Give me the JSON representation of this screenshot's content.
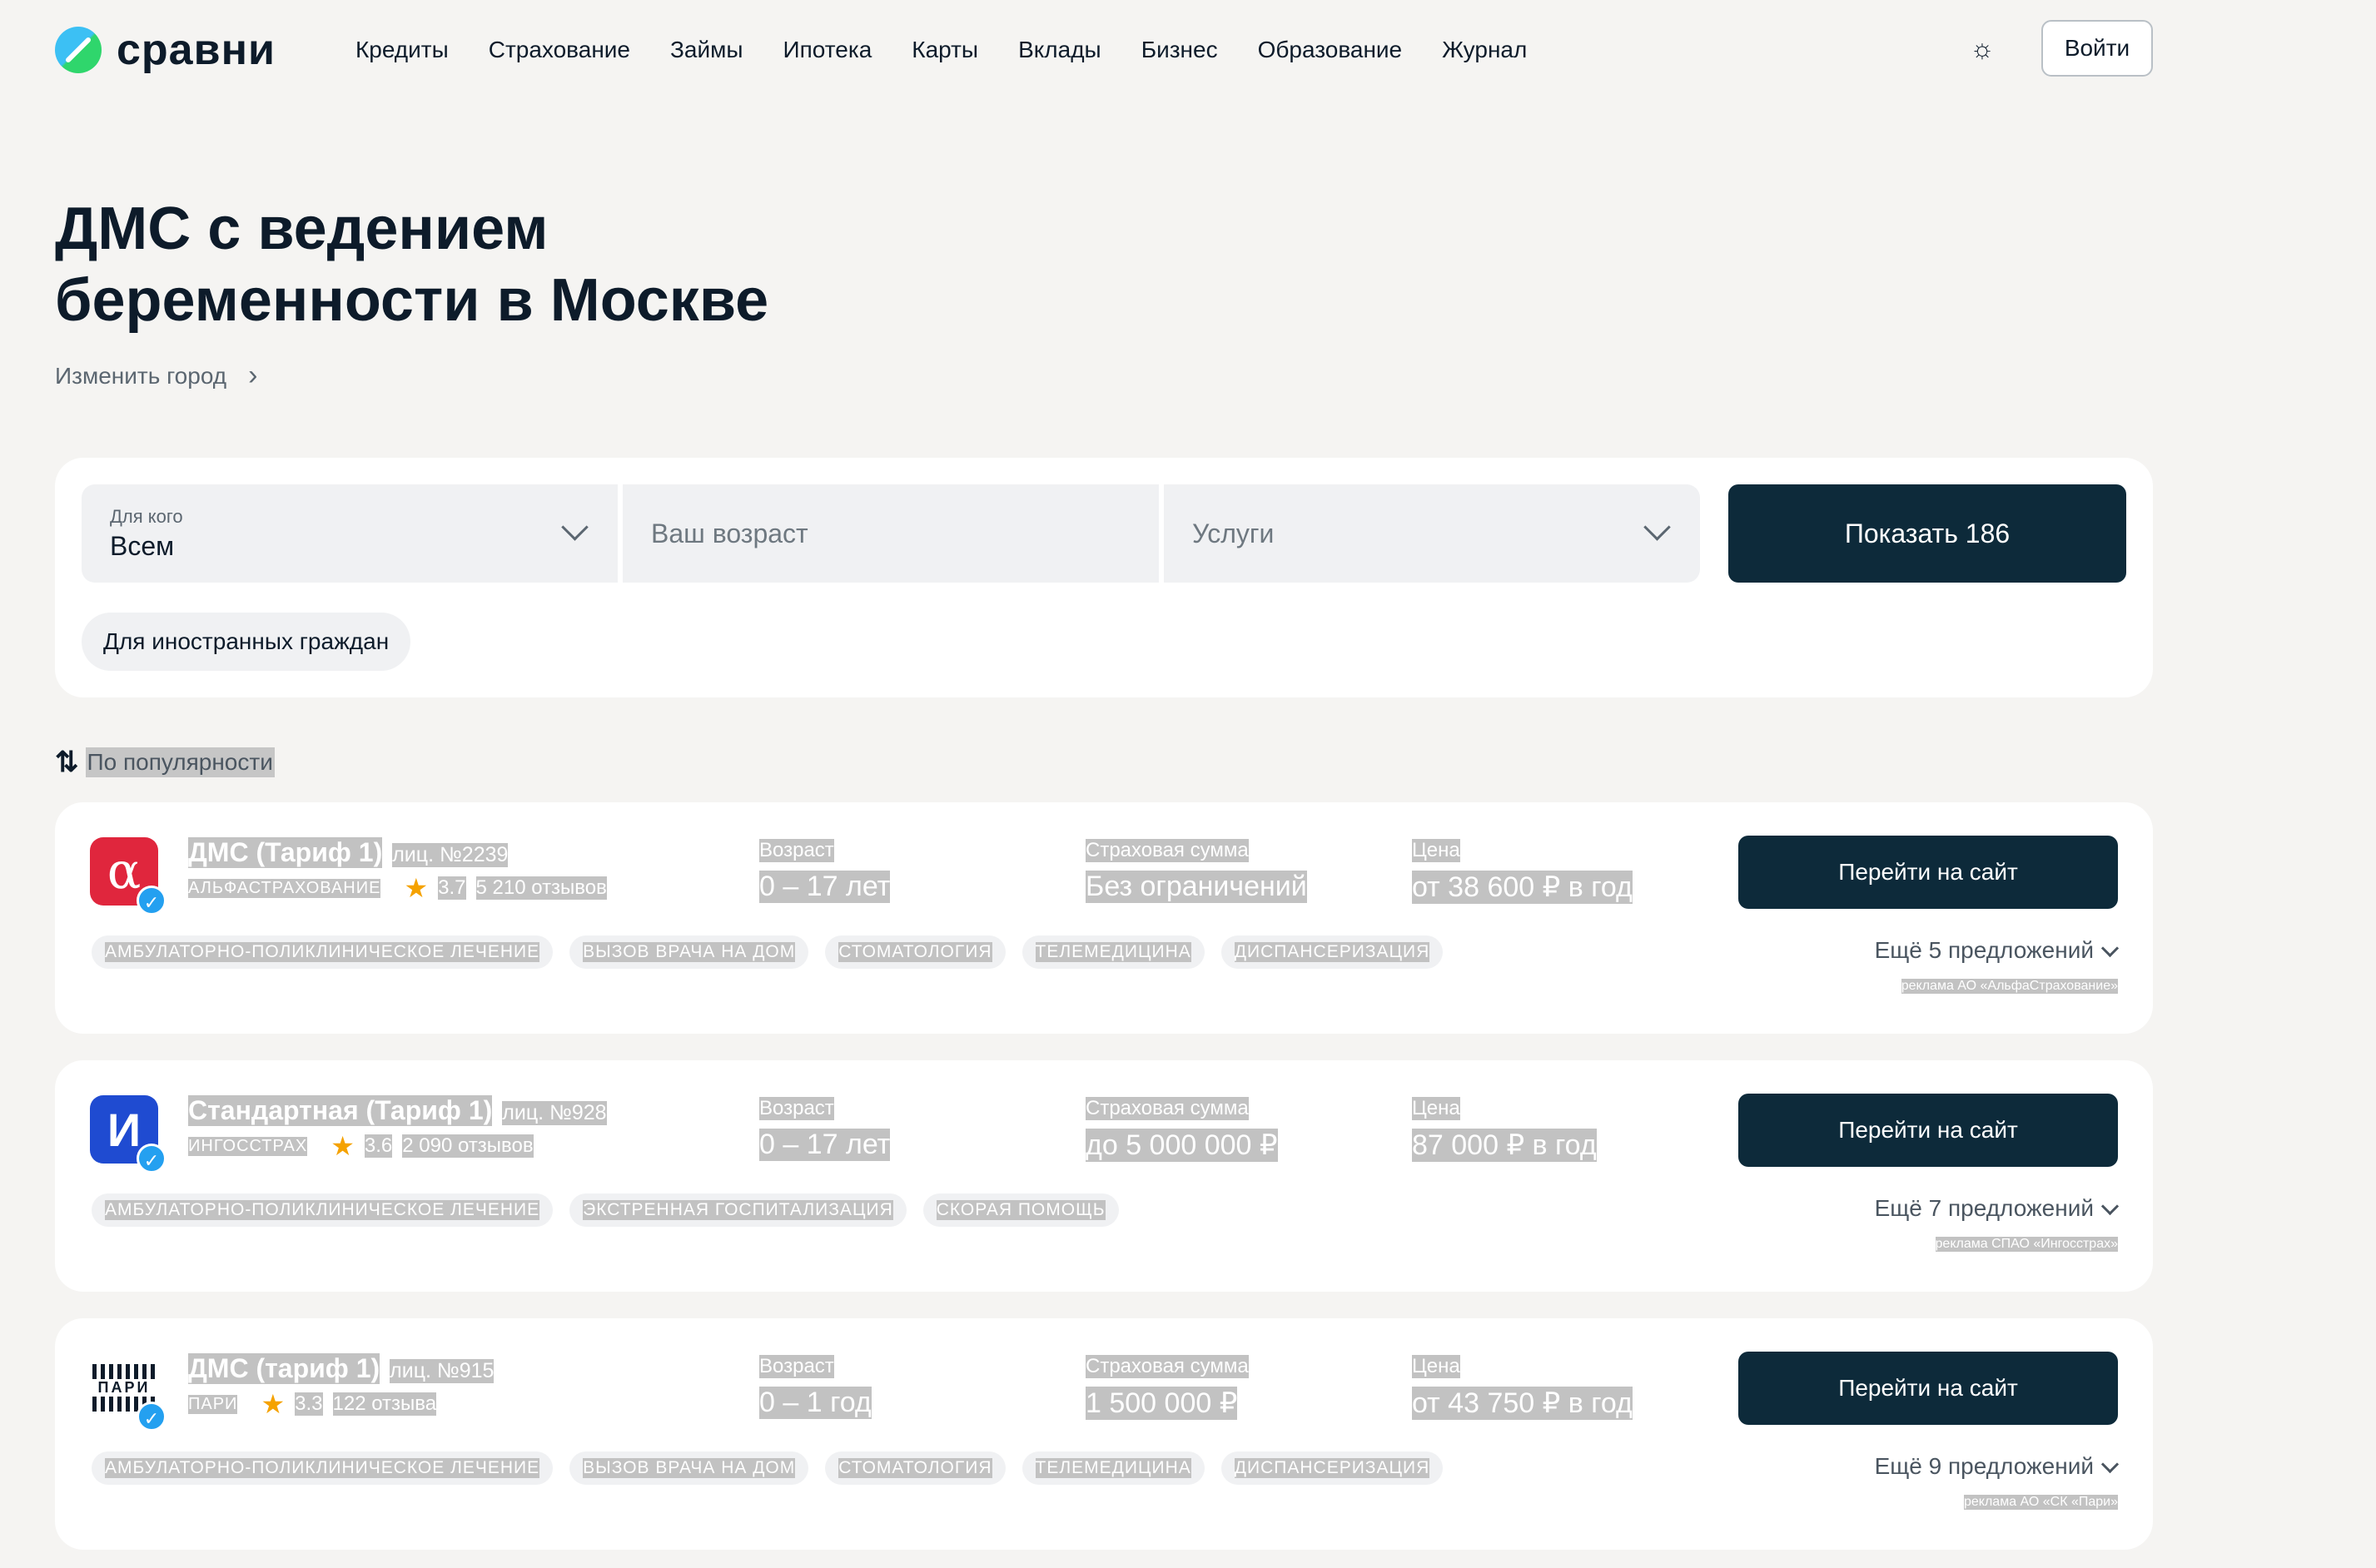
{
  "header": {
    "logo_text": "сравни",
    "nav": [
      "Кредиты",
      "Страхование",
      "Займы",
      "Ипотека",
      "Карты",
      "Вклады",
      "Бизнес",
      "Образование",
      "Журнал"
    ],
    "theme_icon": "sun-icon",
    "login_label": "Войти"
  },
  "page": {
    "title_line1": "ДМС с ведением",
    "title_line2": "беременности в Москве",
    "change_city": "Изменить город"
  },
  "filters": {
    "who_label": "Для кого",
    "who_value": "Всем",
    "age_placeholder": "Ваш возраст",
    "services_placeholder": "Услуги",
    "show_button": "Показать 186",
    "foreign_chip": "Для иностранных граждан"
  },
  "sort": {
    "label": "По популярности",
    "icon": "sort-arrows-icon"
  },
  "labels": {
    "age": "Возраст",
    "sum": "Страховая сумма",
    "price": "Цена",
    "goto": "Перейти на сайт"
  },
  "offers": [
    {
      "product": "ДМС (Тариф 1)",
      "license": "лиц. №2239",
      "company": "АЛЬФАСТРАХОВАНИЕ",
      "logo_glyph": "α",
      "rating": "3.7",
      "reviews": "5 210 отзывов",
      "age": "0 – 17 лет",
      "sum": "Без ограничений",
      "price": "от 38 600 ₽ в год",
      "more": "Ещё 5 предложений",
      "ad": "реклама АО «АльфаСтрахование»",
      "tags": [
        "АМБУЛАТОРНО-ПОЛИКЛИНИЧЕСКОЕ ЛЕЧЕНИЕ",
        "ВЫЗОВ ВРАЧА НА ДОМ",
        "СТОМАТОЛОГИЯ",
        "ТЕЛЕМЕДИЦИНА",
        "ДИСПАНСЕРИЗАЦИЯ"
      ]
    },
    {
      "product": "Стандартная (Тариф 1)",
      "license": "лиц. №928",
      "company": "ИНГОССТРАХ",
      "logo_glyph": "И",
      "rating": "3.6",
      "reviews": "2 090 отзывов",
      "age": "0 – 17 лет",
      "sum": "до 5 000 000 ₽",
      "price": "87 000 ₽ в год",
      "more": "Ещё 7 предложений",
      "ad": "реклама СПАО «Ингосстрах»",
      "tags": [
        "АМБУЛАТОРНО-ПОЛИКЛИНИЧЕСКОЕ ЛЕЧЕНИЕ",
        "ЭКСТРЕННАЯ ГОСПИТАЛИЗАЦИЯ",
        "СКОРАЯ ПОМОЩЬ"
      ]
    },
    {
      "product": "ДМС (тариф 1)",
      "license": "лиц. №915",
      "company": "ПАРИ",
      "logo_glyph": "ПАРИ",
      "rating": "3.3",
      "reviews": "122 отзыва",
      "age": "0 – 1 год",
      "sum": "1 500 000 ₽",
      "price": "от 43 750 ₽ в год",
      "more": "Ещё 9 предложений",
      "ad": "реклама АО «СК «Пари»",
      "tags": [
        "АМБУЛАТОРНО-ПОЛИКЛИНИЧЕСКОЕ ЛЕЧЕНИЕ",
        "ВЫЗОВ ВРАЧА НА ДОМ",
        "СТОМАТОЛОГИЯ",
        "ТЕЛЕМЕДИЦИНА",
        "ДИСПАНСЕРИЗАЦИЯ"
      ]
    }
  ],
  "colors": {
    "primary_dark": "#0d2a3a",
    "background": "#f5f4f2",
    "star": "#f5a200",
    "verified": "#24a0f0"
  }
}
